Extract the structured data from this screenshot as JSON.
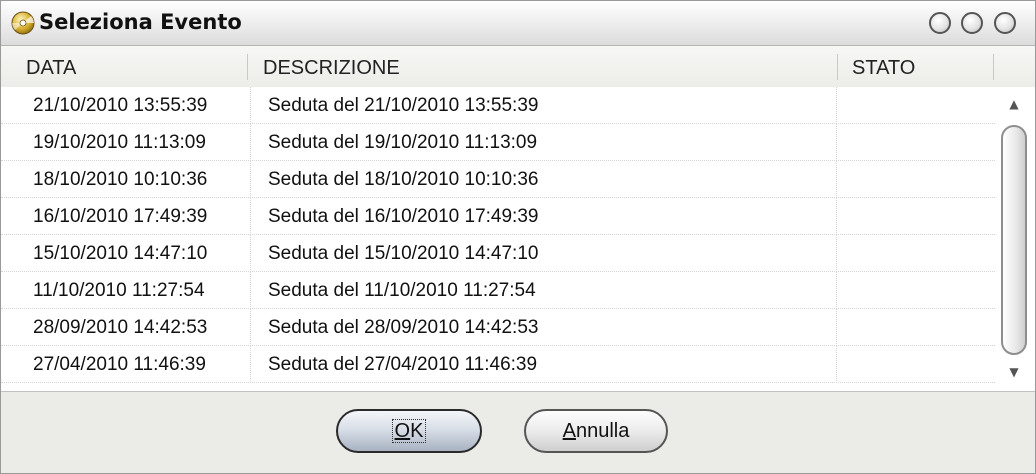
{
  "window": {
    "title": "Seleziona Evento"
  },
  "columns": {
    "data": "DATA",
    "descrizione": "DESCRIZIONE",
    "stato": "STATO"
  },
  "rows": [
    {
      "data": "21/10/2010 13:55:39",
      "descrizione": "Seduta del 21/10/2010 13:55:39",
      "stato": ""
    },
    {
      "data": "19/10/2010 11:13:09",
      "descrizione": "Seduta del 19/10/2010 11:13:09",
      "stato": ""
    },
    {
      "data": "18/10/2010 10:10:36",
      "descrizione": "Seduta del 18/10/2010 10:10:36",
      "stato": ""
    },
    {
      "data": "16/10/2010 17:49:39",
      "descrizione": "Seduta del 16/10/2010 17:49:39",
      "stato": ""
    },
    {
      "data": "15/10/2010 14:47:10",
      "descrizione": "Seduta del 15/10/2010 14:47:10",
      "stato": ""
    },
    {
      "data": "11/10/2010 11:27:54",
      "descrizione": "Seduta del 11/10/2010 11:27:54",
      "stato": ""
    },
    {
      "data": "28/09/2010 14:42:53",
      "descrizione": "Seduta del 28/09/2010 14:42:53",
      "stato": ""
    },
    {
      "data": "27/04/2010 11:46:39",
      "descrizione": "Seduta del 27/04/2010 11:46:39",
      "stato": ""
    }
  ],
  "buttons": {
    "ok": {
      "mnemonic": "O",
      "rest": "K"
    },
    "annulla": {
      "mnemonic": "A",
      "rest": "nnulla"
    }
  },
  "icons": {
    "app": "cd-disc-icon",
    "window_controls": [
      "minimize-icon",
      "maximize-icon",
      "close-icon"
    ],
    "scroll": [
      "scroll-up-icon",
      "scroll-down-icon"
    ]
  }
}
